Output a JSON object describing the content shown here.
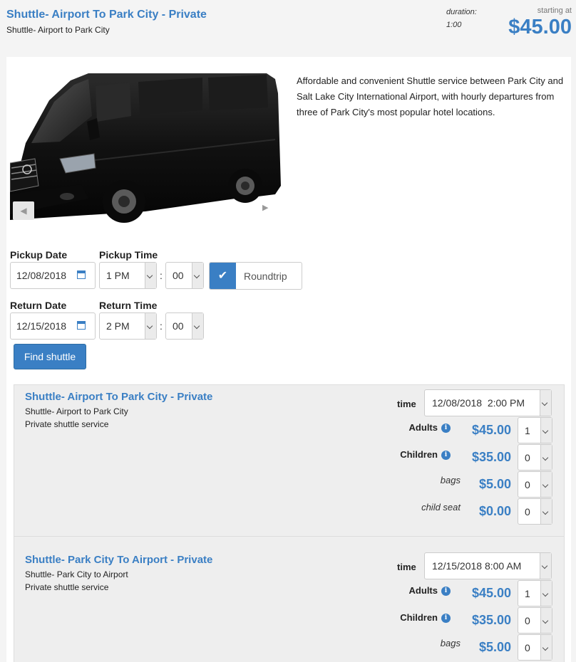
{
  "header": {
    "title": "Shuttle- Airport To Park City - Private",
    "subtitle": "Shuttle- Airport to Park City",
    "duration_label": "duration:",
    "duration_value": "1:00",
    "starting_label": "starting at",
    "starting_price": "$45.00"
  },
  "gallery": {
    "prev_icon": "◀",
    "next_icon": "▶"
  },
  "description": "Affordable and convenient Shuttle service between Park City and Salt Lake City International Airport, with hourly departures from three of Park City's most popular hotel locations.",
  "form": {
    "pickup_date_label": "Pickup Date",
    "pickup_date": "12/08/2018",
    "pickup_time_label": "Pickup Time",
    "pickup_hour": "1 PM",
    "pickup_minute": "00",
    "colon": ":",
    "roundtrip_check": "✔",
    "roundtrip_label": "Roundtrip",
    "return_date_label": "Return Date",
    "return_date": "12/15/2018",
    "return_time_label": "Return Time",
    "return_hour": "2 PM",
    "return_minute": "00",
    "find_button": "Find shuttle"
  },
  "results": [
    {
      "title": "Shuttle- Airport To Park City - Private",
      "subtitle": "Shuttle- Airport to Park City",
      "description": "Private shuttle service",
      "time_label": "time",
      "time_value": "12/08/2018  2:00 PM",
      "rows": [
        {
          "label": "Adults",
          "price": "$45.00",
          "qty": "1"
        },
        {
          "label": "Children",
          "price": "$35.00",
          "qty": "0"
        },
        {
          "label": "bags",
          "price": "$5.00",
          "qty": "0"
        },
        {
          "label": "child seat",
          "price": "$0.00",
          "qty": "0"
        }
      ]
    },
    {
      "title": "Shuttle- Park City To Airport - Private",
      "subtitle": "Shuttle- Park City to Airport",
      "description": "Private shuttle service",
      "time_label": "time",
      "time_value": "12/15/2018 8:00 AM",
      "rows": [
        {
          "label": "Adults",
          "price": "$45.00",
          "qty": "1"
        },
        {
          "label": "Children",
          "price": "$35.00",
          "qty": "0"
        },
        {
          "label": "bags",
          "price": "$5.00",
          "qty": "0"
        }
      ]
    }
  ],
  "info_icon_glyph": "i",
  "colors": {
    "accent": "#3a7fc4",
    "panel_bg": "#eeeeee",
    "page_bg": "#f4f4f4"
  }
}
